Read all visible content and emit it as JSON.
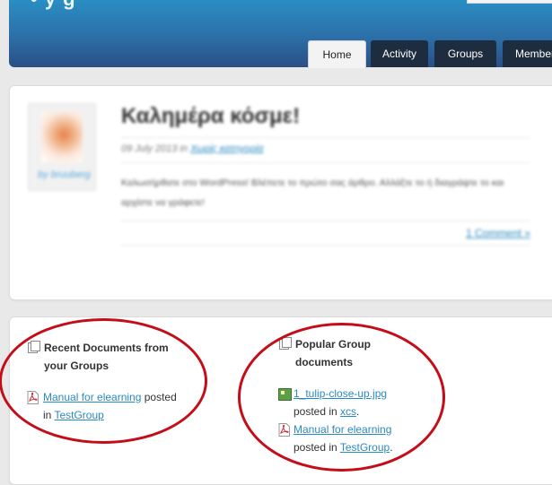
{
  "header": {
    "logo_fragment": "• y  g",
    "tabs": [
      {
        "label": "Home",
        "active": true
      },
      {
        "label": "Activity",
        "active": false
      },
      {
        "label": "Groups",
        "active": false
      },
      {
        "label": "Members",
        "active": false
      }
    ]
  },
  "post": {
    "title": "Καλημέρα κόσμε!",
    "date": "09 July 2013 in",
    "category": "Χωρίς κατηγορία",
    "body": "Καλωσήρθατε στο WordPress! Βλέπετε το πρώτο σας άρθρο. Αλλάξτε το ή διαγράψτε το και αρχίστε να γράφετε!",
    "comment_link": "1 Comment »",
    "author_prefix": "by",
    "author": "bruuberg"
  },
  "recent_docs": {
    "title_line1": "Recent Documents from",
    "title_line2": "your Groups",
    "items": [
      {
        "name": "Manual for elearning",
        "posted_text": "posted",
        "in_text": "in",
        "group": "TestGroup"
      }
    ]
  },
  "popular_docs": {
    "title_line1": "Popular Group",
    "title_line2": "documents",
    "items": [
      {
        "name": "1_tulip-close-up.jpg",
        "posted_text": "posted in",
        "group": "xcs",
        "type": "image"
      },
      {
        "name": "Manual for elearning",
        "posted_text": "posted in",
        "group": "TestGroup",
        "type": "pdf"
      }
    ]
  },
  "colors": {
    "header_top": "#2a8ec4",
    "tab_dark": "#1d2c3f",
    "link": "#2a8ac0",
    "annotation_ring": "#c40d18"
  }
}
